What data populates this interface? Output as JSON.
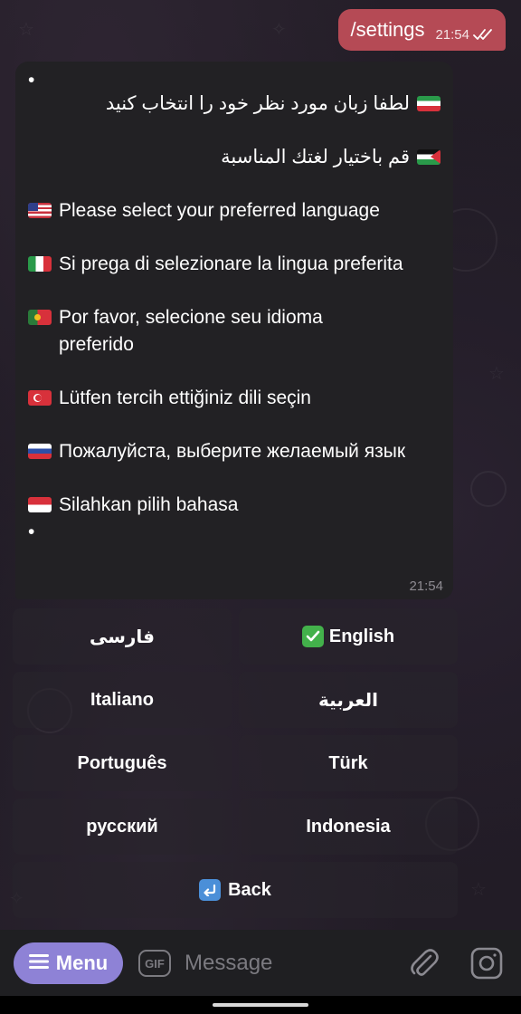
{
  "outgoing": {
    "text": "/settings",
    "time": "21:54"
  },
  "incoming": {
    "bullet_top": "•",
    "bullet_bottom": "•",
    "lines": [
      {
        "flag": "flag-ir",
        "dir": "rtl",
        "text": "لطفا زبان مورد نظر خود را انتخاب کنید"
      },
      {
        "flag": "flag-ps",
        "dir": "rtl",
        "text": "قم باختيار لغتك المناسبة"
      },
      {
        "flag": "flag-us",
        "dir": "ltr",
        "text": "Please select your preferred language"
      },
      {
        "flag": "flag-it",
        "dir": "ltr",
        "text": "Si prega di selezionare la lingua preferita"
      },
      {
        "flag": "flag-pt",
        "dir": "ltr",
        "text": "Por favor, selecione seu idioma preferido"
      },
      {
        "flag": "flag-tr",
        "dir": "ltr",
        "text": "Lütfen tercih ettiğiniz dili seçin"
      },
      {
        "flag": "flag-ru",
        "dir": "ltr",
        "text": "Пожалуйста, выберите желаемый язык"
      },
      {
        "flag": "flag-id",
        "dir": "ltr",
        "text": "Silahkan pilih bahasa"
      }
    ],
    "time": "21:54"
  },
  "keyboard": {
    "rows": [
      [
        {
          "label": "فارسی"
        },
        {
          "label": "English",
          "icon": "check-mark-icon"
        }
      ],
      [
        {
          "label": "Italiano"
        },
        {
          "label": "العربية"
        }
      ],
      [
        {
          "label": "Português"
        },
        {
          "label": "Türk"
        }
      ],
      [
        {
          "label": "русский"
        },
        {
          "label": "Indonesia"
        }
      ]
    ],
    "back": {
      "label": "Back",
      "icon": "back-arrow-icon"
    }
  },
  "input_bar": {
    "menu_label": "Menu",
    "gif_label": "GIF",
    "placeholder": "Message"
  },
  "colors": {
    "outgoing_bubble": "#b54a55",
    "incoming_bubble": "#222124",
    "menu_button": "#8e82d6",
    "check_green": "#43b14b",
    "back_blue": "#4b8fd8"
  }
}
